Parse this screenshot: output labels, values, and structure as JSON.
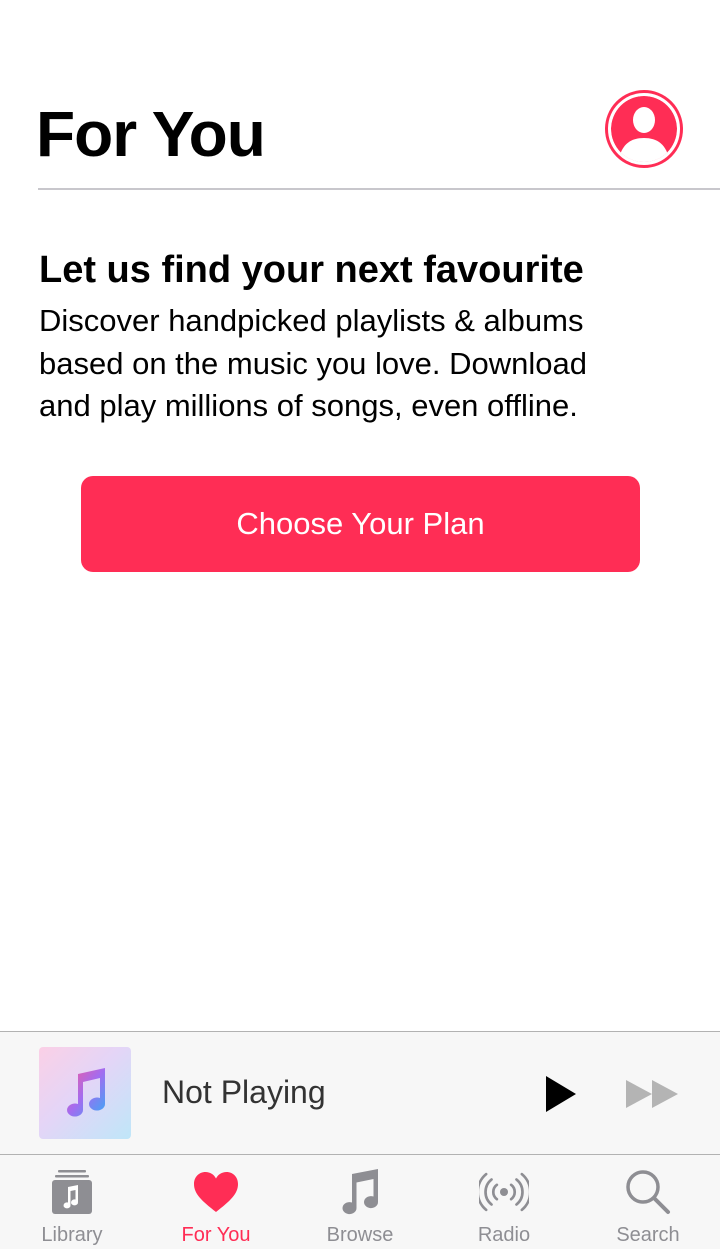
{
  "header": {
    "title": "For You",
    "avatar_icon": "person-icon"
  },
  "promo": {
    "headline": "Let us find your next favourite",
    "body_lines": [
      "Discover handpicked playlists & albums",
      "based on the music you love. Download",
      "and play millions of songs, even offline."
    ],
    "cta_label": "Choose Your Plan"
  },
  "mini_player": {
    "status": "Not Playing",
    "artwork_icon": "music-note-icon",
    "play_icon": "play-icon",
    "forward_icon": "fast-forward-icon"
  },
  "tabs": [
    {
      "label": "Library",
      "icon": "library-icon",
      "active": false
    },
    {
      "label": "For You",
      "icon": "heart-icon",
      "active": true
    },
    {
      "label": "Browse",
      "icon": "music-note-icon",
      "active": false
    },
    {
      "label": "Radio",
      "icon": "radio-icon",
      "active": false
    },
    {
      "label": "Search",
      "icon": "search-icon",
      "active": false
    }
  ],
  "colors": {
    "accent": "#ff2d55",
    "inactive": "#8e8e93",
    "divider": "#c8c7cc"
  }
}
